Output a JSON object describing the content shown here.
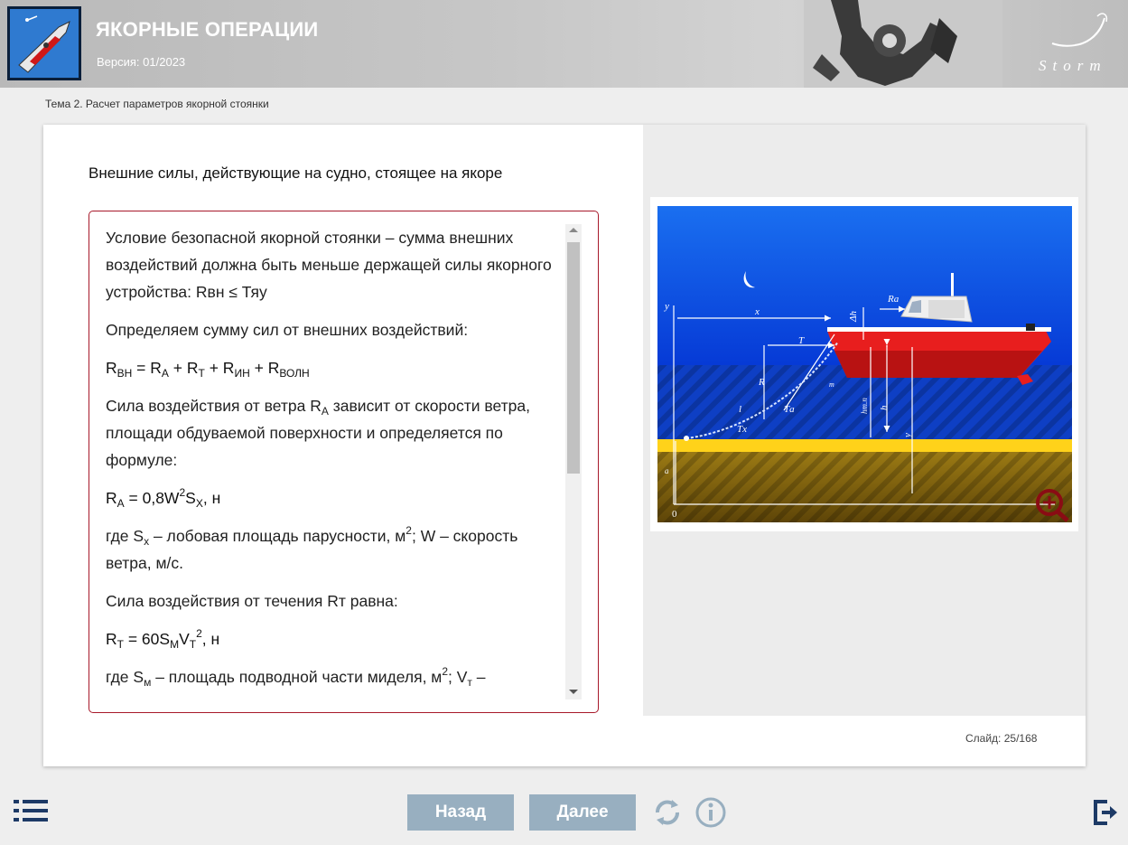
{
  "header": {
    "title": "ЯКОРНЫЕ ОПЕРАЦИИ",
    "version": "Версия: 01/2023",
    "brand": "Storm",
    "logo_icon": "ship-icon",
    "anchor_icon": "anchor-image"
  },
  "breadcrumb": "Тема 2. Расчет параметров якорной стоянки",
  "slide": {
    "title": "Внешние силы, действующие на судно, стоящее на якоре",
    "counter": "Слайд: 25/168"
  },
  "content": {
    "p1": "Условие безопасной якорной стоянки – сумма внешних воздействий должна быть меньше держащей силы якорного устройства: Rвн ≤ Тяу",
    "p2": "Определяем сумму сил от внешних воздействий:",
    "f1": {
      "lhs": "R",
      "lhs_sub": "ВН",
      "eq": " = R",
      "a_sub": "А",
      "plus1": " + R",
      "t_sub": "Т",
      "plus2": " + R",
      "in_sub": "ИН",
      "plus3": " + R",
      "voln_sub": "ВОЛН"
    },
    "p3": {
      "a": "Сила воздействия от ветра R",
      "sub": "A",
      "b": " зависит от скорости ветра, площади обдуваемой поверхности и определяется по формуле:"
    },
    "f2": {
      "a": "R",
      "a_sub": "A",
      "b": " = 0,8W",
      "sup": "2",
      "c": "S",
      "c_sub": "X",
      "d": ", н"
    },
    "p4": {
      "a": "где S",
      "sub": "x",
      "b": " – лобовая площадь парусности, м",
      "sup": "2",
      "c": "; W – скорость ветра, м/с."
    },
    "p5": "Сила воздействия от течения Rт равна:",
    "f3": {
      "a": "R",
      "a_sub": "Т",
      "b": " = 60S",
      "b_sub": "М",
      "c": "V",
      "c_sub": "Т",
      "sup": "2",
      "d": ", н"
    },
    "p6": {
      "a": "где S",
      "sub": "м",
      "b": " – площадь подводной части миделя, м",
      "sup": "2",
      "c": "; V",
      "sub2": "т",
      "d": " –"
    }
  },
  "diagram": {
    "labels": {
      "y": "y",
      "x": "x",
      "ra": "Rа",
      "dh": "Δh",
      "t": "T",
      "r": "R",
      "m": "m",
      "ta": "Tа",
      "l": "l",
      "tx": "Tx",
      "hm": "hт.п",
      "h": "h",
      "y2": "y",
      "a": "a",
      "origin": "0"
    },
    "colors": {
      "sky": "#0a3fd8",
      "sea": "#0f42c8",
      "sand": "#ffd21a",
      "ground": "#8a6a14",
      "hull": "#e81e1e"
    },
    "zoom_icon": "zoom-in-icon"
  },
  "footer": {
    "back": "Назад",
    "next": "Далее",
    "menu_icon": "menu-list-icon",
    "reload_icon": "reload-icon",
    "info_icon": "info-icon",
    "exit_icon": "exit-icon"
  }
}
